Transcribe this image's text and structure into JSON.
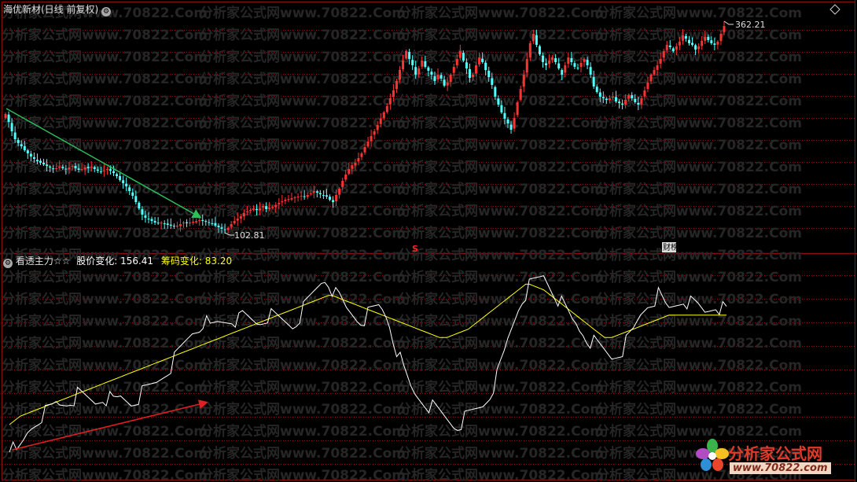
{
  "top_panel": {
    "title": "海优新材(日线 前复权)",
    "high_label": "362.21",
    "low_label": "102.81",
    "signal_s": "S",
    "signal_ts": "财榜"
  },
  "bottom_panel": {
    "indicator_name": "看透主力☆☆",
    "line1_label": "股价变化:",
    "line1_value": "156.41",
    "line2_label": "筹码变化:",
    "line2_value": "83.20"
  },
  "watermark": "分析家公式网www.70822.Com",
  "logo": {
    "name": "分析家公式网",
    "url": "www.70822.com"
  },
  "colors": {
    "up": "#ff3232",
    "down": "#54ffff",
    "grid": "#8a1010",
    "line1": "#ffffff",
    "line2": "#ffff00",
    "arrow_top": "#2ebd5a",
    "arrow_bottom": "#e02020"
  },
  "chart_data": [
    {
      "type": "candlestick",
      "title": "海优新材(日线 前复权)",
      "annotations": [
        {
          "label": "362.21",
          "kind": "high"
        },
        {
          "label": "102.81",
          "kind": "low"
        }
      ],
      "ylim": [
        95,
        370
      ],
      "close": [
        250,
        240,
        228,
        218,
        213,
        209,
        204,
        200,
        196,
        193,
        190,
        188,
        186,
        184,
        182,
        180,
        181,
        183,
        181,
        180,
        182,
        184,
        181,
        179,
        180,
        182,
        181,
        183,
        180,
        178,
        176,
        178,
        180,
        178,
        175,
        171,
        166,
        162,
        158,
        152,
        146,
        138,
        130,
        122,
        118,
        116,
        114,
        112,
        111,
        112,
        110,
        109,
        108,
        107,
        108,
        110,
        112,
        111,
        112,
        113,
        114,
        115,
        114,
        113,
        112,
        111,
        108,
        106,
        104,
        103,
        105,
        110,
        114,
        117,
        120,
        124,
        126,
        128,
        130,
        128,
        130,
        133,
        129,
        131,
        132,
        134,
        137,
        139,
        141,
        142,
        143,
        144,
        145,
        146,
        145,
        147,
        149,
        152,
        150,
        148,
        146,
        145,
        141,
        138,
        147,
        155,
        165,
        173,
        180,
        185,
        188,
        194,
        200,
        208,
        215,
        222,
        228,
        236,
        244,
        252,
        260,
        270,
        280,
        292,
        306,
        318,
        330,
        320,
        312,
        300,
        308,
        318,
        310,
        305,
        300,
        292,
        300,
        295,
        286,
        290,
        300,
        310,
        320,
        330,
        318,
        308,
        296,
        300,
        312,
        322,
        316,
        306,
        297,
        287,
        272,
        262,
        252,
        244,
        238,
        230,
        245,
        265,
        282,
        300,
        320,
        340,
        352,
        338,
        326,
        316,
        312,
        318,
        322,
        316,
        308,
        300,
        312,
        322,
        316,
        310,
        308,
        315,
        320,
        312,
        300,
        285,
        278,
        272,
        270,
        268,
        270,
        272,
        266,
        264,
        262,
        268,
        274,
        270,
        265,
        262,
        270,
        280,
        290,
        300,
        306,
        312,
        320,
        330,
        338,
        335,
        330,
        336,
        342,
        350,
        346,
        340,
        338,
        332,
        336,
        343,
        348,
        344,
        340,
        338,
        342,
        352,
        362
      ]
    },
    {
      "type": "line",
      "series": [
        {
          "name": "股价变化",
          "values": [
            -6,
            -10,
            -14,
            -9,
            -4,
            2,
            6,
            9,
            12,
            15,
            16,
            18,
            20,
            23,
            22,
            23,
            24,
            26,
            27,
            29,
            28,
            27,
            26,
            25,
            24,
            26,
            28,
            27,
            26,
            24,
            25,
            27,
            26,
            25,
            24,
            26,
            28,
            30,
            32,
            34,
            36,
            38,
            41,
            44,
            47,
            50,
            54,
            58,
            62,
            66,
            70,
            74,
            76,
            78,
            82,
            80,
            76,
            78,
            80,
            81,
            82,
            83,
            84,
            83,
            82,
            85,
            84,
            83,
            82,
            81,
            82,
            84,
            86,
            85,
            84,
            83,
            82,
            81,
            80,
            79,
            82,
            86,
            90,
            94,
            98,
            102,
            106,
            110,
            112,
            110,
            105,
            100,
            98,
            94,
            90,
            88,
            86,
            84,
            83,
            84,
            86,
            88,
            90,
            92,
            90,
            86,
            80,
            70,
            62,
            54,
            46,
            40,
            34,
            30,
            28,
            26,
            24,
            22,
            20,
            18,
            16,
            14,
            12,
            10,
            8,
            8,
            10,
            12,
            14,
            16,
            18,
            20,
            22,
            26,
            30,
            36,
            42,
            50,
            58,
            68,
            76,
            84,
            92,
            98,
            102,
            106,
            108,
            110,
            112,
            114,
            110,
            106,
            102,
            98,
            94,
            90,
            86,
            82,
            80,
            76,
            74,
            70,
            68,
            66,
            64,
            62,
            60,
            58,
            56,
            58,
            60,
            62,
            66,
            70,
            74,
            80,
            86,
            90,
            94,
            96,
            98,
            100,
            96,
            92,
            90,
            92,
            94,
            96,
            98,
            96,
            94,
            93,
            92,
            90,
            88,
            90,
            92,
            94,
            92,
            90,
            88
          ]
        },
        {
          "name": "筹码变化",
          "values": [
            8,
            10,
            12,
            14,
            15,
            16,
            17,
            18,
            19,
            20,
            21,
            22,
            23,
            24,
            25,
            26,
            27,
            28,
            29,
            30,
            31,
            32,
            33,
            34,
            35,
            36,
            37,
            38,
            39,
            40,
            41,
            42,
            43,
            44,
            45,
            46,
            47,
            48,
            49,
            50,
            51,
            52,
            53,
            54,
            55,
            56,
            57,
            58,
            59,
            60,
            61,
            62,
            63,
            64,
            65,
            66,
            67,
            68,
            69,
            70,
            71,
            72,
            73,
            74,
            75,
            76,
            77,
            78,
            79,
            80,
            81,
            82,
            83,
            84,
            85,
            86,
            87,
            88,
            89,
            90,
            91,
            92,
            93,
            94,
            95,
            96,
            97,
            98,
            99,
            100,
            100,
            99,
            98,
            97,
            96,
            95,
            94,
            93,
            92,
            91,
            90,
            89,
            88,
            87,
            86,
            85,
            84,
            83,
            82,
            81,
            80,
            79,
            78,
            77,
            76,
            75,
            74,
            73,
            72,
            71,
            70,
            70,
            70,
            71,
            72,
            73,
            74,
            75,
            76,
            78,
            80,
            82,
            84,
            86,
            88,
            90,
            92,
            94,
            96,
            98,
            100,
            102,
            104,
            106,
            108,
            108,
            107,
            106,
            105,
            104,
            102,
            100,
            98,
            96,
            94,
            92,
            90,
            88,
            86,
            84,
            82,
            80,
            78,
            76,
            74,
            72,
            70,
            70,
            70,
            71,
            72,
            73,
            74,
            75,
            76,
            77,
            78,
            79,
            80,
            81,
            82,
            83,
            84,
            85,
            86,
            86,
            86,
            86,
            86,
            86,
            86,
            86,
            86,
            86,
            86,
            86,
            86,
            86,
            86,
            86,
            86
          ]
        }
      ],
      "ylim": [
        -20,
        120
      ]
    }
  ]
}
